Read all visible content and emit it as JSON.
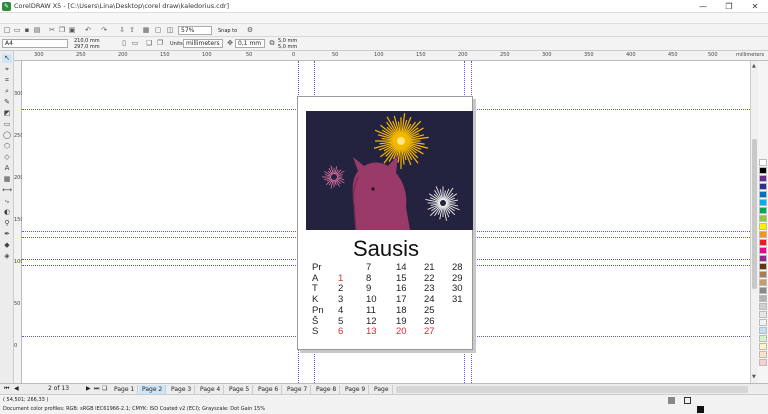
{
  "window": {
    "title": "CorelDRAW X5 - [C:\\Users\\Lina\\Desktop\\corel draw\\kaledorius.cdr]",
    "minimize": "—",
    "maximize": "❐",
    "close": "✕"
  },
  "toolbar": {
    "zoom": "57%",
    "snap_to": "Snap to"
  },
  "property_bar": {
    "paper_size": "A4",
    "width": "210,0 mm",
    "height": "297,0 mm",
    "units_label": "Units:",
    "units": "millimeters",
    "nudge": "0,1 mm",
    "dup_x": "5,0 mm",
    "dup_y": "5,0 mm"
  },
  "ruler": {
    "h_ticks": [
      "300",
      "250",
      "200",
      "150",
      "100",
      "50",
      "0",
      "50",
      "100",
      "150",
      "200",
      "250",
      "300",
      "350",
      "400",
      "450",
      "500"
    ],
    "unit_label": "millimeters",
    "v_ticks": [
      "300",
      "250",
      "200",
      "150",
      "100",
      "50",
      "0"
    ]
  },
  "calendar": {
    "month": "Sausis",
    "day_labels": [
      "Pr",
      "A",
      "T",
      "K",
      "Pn",
      "Š",
      "S"
    ],
    "weeks": [
      [
        "",
        "1",
        "2",
        "3",
        "4",
        "5",
        "6"
      ],
      [
        "7",
        "8",
        "9",
        "10",
        "11",
        "12",
        "13"
      ],
      [
        "14",
        "15",
        "16",
        "17",
        "18",
        "19",
        "20"
      ],
      [
        "21",
        "22",
        "23",
        "24",
        "25",
        "26",
        "27"
      ],
      [
        "28",
        "29",
        "30",
        "31",
        "",
        "",
        ""
      ]
    ],
    "accent_color": "#d62f2f"
  },
  "page_nav": {
    "counter": "2 of 13",
    "tabs": [
      "Page 1",
      "Page 2",
      "Page 3",
      "Page 4",
      "Page 5",
      "Page 6",
      "Page 7",
      "Page 8",
      "Page 9",
      "Page"
    ],
    "active_index": 1
  },
  "status": {
    "coords": "( 54,501; 266,33 )",
    "profiles": "Document color profiles: RGB: sRGB IEC61966-2.1; CMYK: ISO Coated v2 (ECI); Grayscale: Dot Gain 15%"
  },
  "palette": [
    "#ffffff",
    "#000000",
    "#6b2c91",
    "#2e3192",
    "#0072bc",
    "#00aeef",
    "#00a651",
    "#8dc63f",
    "#fff200",
    "#f7941d",
    "#ed1c24",
    "#ec008c",
    "#92278f",
    "#603913",
    "#a67c52",
    "#c69c6d",
    "#898989",
    "#b3b3b3",
    "#d0d0d0",
    "#e6e6e6",
    "#f2f2f2",
    "#c2e0f4",
    "#d7f0c6",
    "#fff5c0",
    "#fde0c5",
    "#f9cfd2"
  ]
}
